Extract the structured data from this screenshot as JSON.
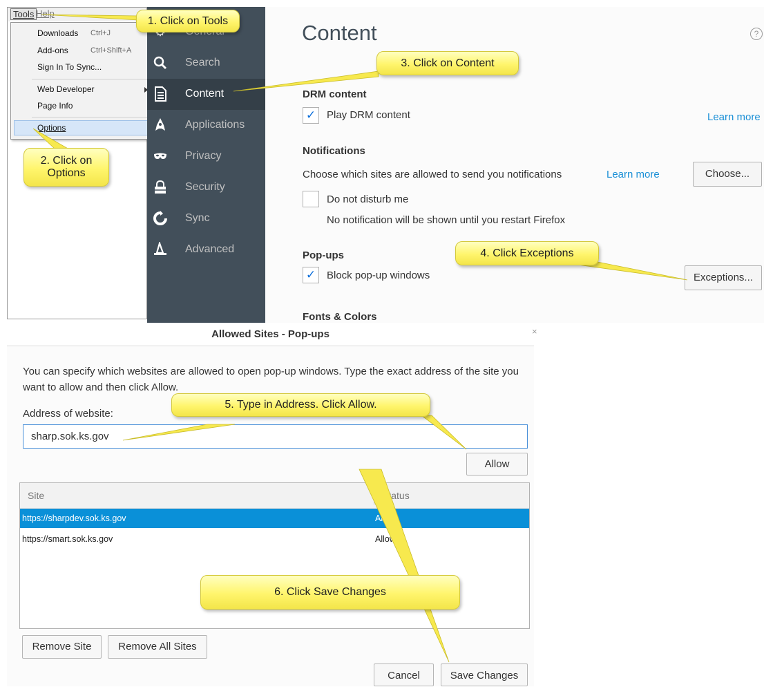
{
  "menubar": {
    "tools": "Tools",
    "help": "Help"
  },
  "tools_menu": {
    "downloads": "Downloads",
    "downloads_shortcut": "Ctrl+J",
    "addons": "Add-ons",
    "addons_shortcut": "Ctrl+Shift+A",
    "sync": "Sign In To Sync...",
    "web_developer": "Web Developer",
    "page_info": "Page Info",
    "options": "Options"
  },
  "sidebar": {
    "items": [
      {
        "label": "General",
        "icon": "gear-icon"
      },
      {
        "label": "Search",
        "icon": "search-icon"
      },
      {
        "label": "Content",
        "icon": "document-icon"
      },
      {
        "label": "Applications",
        "icon": "rocket-icon"
      },
      {
        "label": "Privacy",
        "icon": "mask-icon"
      },
      {
        "label": "Security",
        "icon": "lock-icon"
      },
      {
        "label": "Sync",
        "icon": "sync-icon"
      },
      {
        "label": "Advanced",
        "icon": "wizard-hat-icon"
      }
    ]
  },
  "content": {
    "title": "Content",
    "help": "?",
    "drm": {
      "heading": "DRM content",
      "checkbox": "Play DRM content",
      "checked": true,
      "learn_more": "Learn more"
    },
    "notifications": {
      "heading": "Notifications",
      "text": "Choose which sites are allowed to send you notifications",
      "learn_more": "Learn more",
      "choose": "Choose...",
      "dnd": "Do not disturb me",
      "dnd_checked": false,
      "dnd_note": "No notification will be shown until you restart Firefox"
    },
    "popups": {
      "heading": "Pop-ups",
      "checkbox": "Block pop-up windows",
      "checked": true,
      "exceptions": "Exceptions..."
    },
    "fonts_heading": "Fonts & Colors"
  },
  "dialog": {
    "title": "Allowed Sites - Pop-ups",
    "close": "×",
    "intro": "You can specify which websites are allowed to open pop-up windows. Type the exact address of the site you want to allow and then click Allow.",
    "address_label": "Address of website:",
    "address_value": "sharp.sok.ks.gov",
    "allow": "Allow",
    "columns": {
      "site": "Site",
      "status": "Status"
    },
    "rows": [
      {
        "site": "https://sharpdev.sok.ks.gov",
        "status": "Allow",
        "selected": true
      },
      {
        "site": "https://smart.sok.ks.gov",
        "status": "Allow",
        "selected": false
      }
    ],
    "remove_site": "Remove Site",
    "remove_all": "Remove All Sites",
    "cancel": "Cancel",
    "save": "Save Changes"
  },
  "callouts": {
    "step1": "1. Click on Tools",
    "step2_line1": "2. Click on",
    "step2_line2": "Options",
    "step3": "3. Click on Content",
    "step4": "4. Click Exceptions",
    "step5": "5. Type in Address. Click Allow.",
    "step6": "6. Click Save Changes"
  },
  "colors": {
    "sidebar": "#424f5a",
    "accent": "#0a90d8",
    "callout": "#fff56c"
  }
}
